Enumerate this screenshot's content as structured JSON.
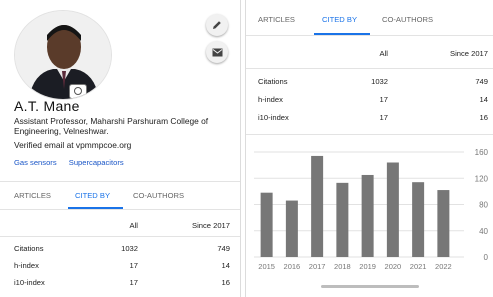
{
  "profile": {
    "name": "A.T. Mane",
    "affiliation": "Assistant Professor, Maharshi Parshuram College of Engineering, Velneshwar.",
    "email": "Verified email at vpmmpcoe.org",
    "interests": [
      "Gas sensors",
      "Supercapacitors"
    ]
  },
  "tabs": [
    "ARTICLES",
    "CITED BY",
    "CO-AUTHORS"
  ],
  "active_tab": "CITED BY",
  "stats": {
    "col_all": "All",
    "col_since": "Since 2017",
    "rows": [
      {
        "label": "Citations",
        "all": "1032",
        "since": "749"
      },
      {
        "label": "h-index",
        "all": "17",
        "since": "14"
      },
      {
        "label": "i10-index",
        "all": "17",
        "since": "16"
      }
    ]
  },
  "icons": [
    "edit-pencil-icon",
    "email-icon",
    "camera-icon"
  ],
  "colors": {
    "accent": "#1a73e8",
    "bar": "#777777",
    "link": "#1a56c7"
  },
  "chart_data": {
    "type": "bar",
    "categories": [
      "2015",
      "2016",
      "2017",
      "2018",
      "2019",
      "2020",
      "2021",
      "2022"
    ],
    "values": [
      98,
      86,
      154,
      113,
      125,
      144,
      114,
      102
    ],
    "ylim": [
      0,
      160
    ],
    "yticks": [
      "0",
      "40",
      "80",
      "120",
      "160"
    ],
    "grid": true
  }
}
